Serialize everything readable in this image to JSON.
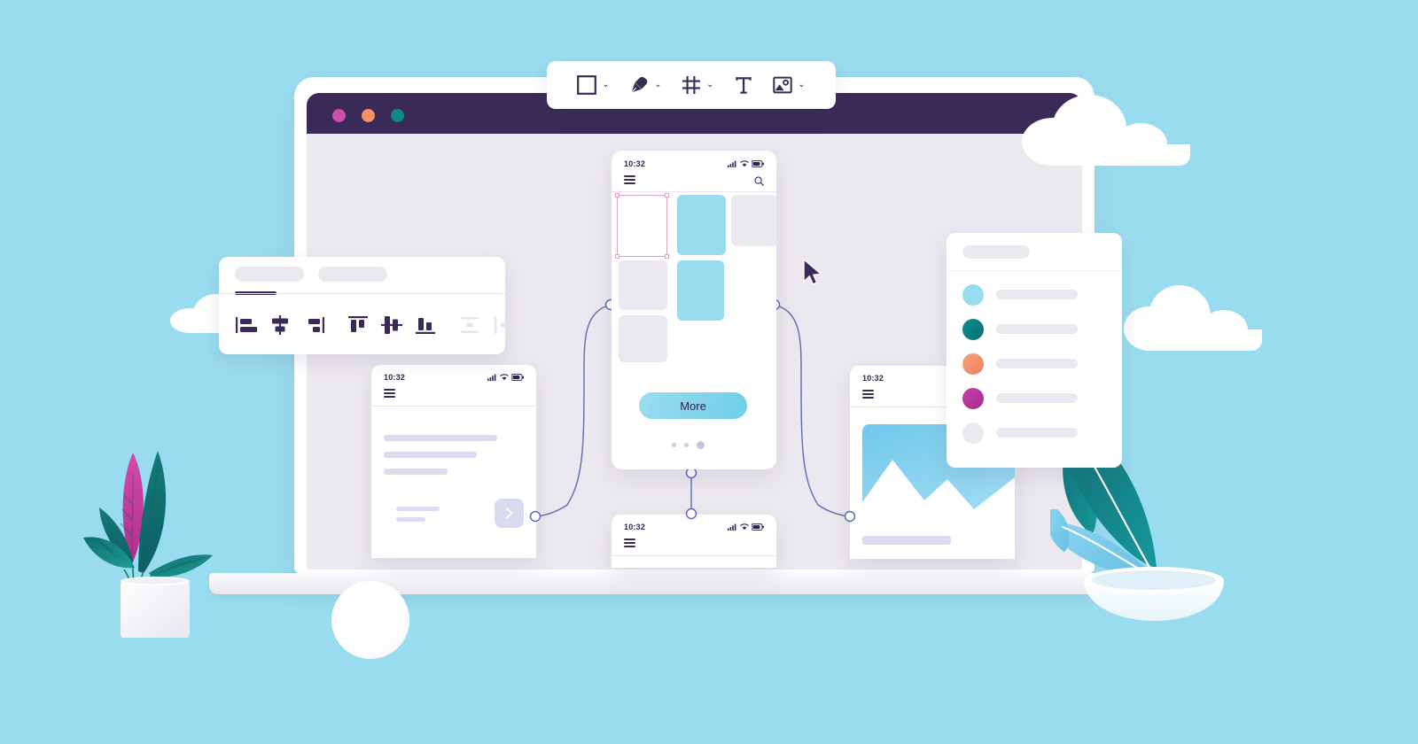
{
  "canvas": {
    "background_color": "#9adcef",
    "app_kind": "ui-design-tool-illustration"
  },
  "laptop": {
    "titlebar_color": "#3a2a57",
    "screen_color": "#ece8ef",
    "traffic_lights": [
      {
        "name": "close",
        "color": "#cf4fae"
      },
      {
        "name": "minimize",
        "color": "#f98e62"
      },
      {
        "name": "maximize",
        "color": "#0b8b8b"
      }
    ]
  },
  "top_toolbar": {
    "tools": [
      {
        "id": "shape",
        "icon": "square-icon",
        "label": "Shape",
        "has_dropdown": true
      },
      {
        "id": "pen",
        "icon": "pen-icon",
        "label": "Pen",
        "has_dropdown": true
      },
      {
        "id": "frame",
        "icon": "grid-frame-icon",
        "label": "Frame",
        "has_dropdown": true
      },
      {
        "id": "text",
        "icon": "text-t-icon",
        "label": "Text",
        "has_dropdown": false
      },
      {
        "id": "image",
        "icon": "image-icon",
        "label": "Image",
        "has_dropdown": true
      }
    ],
    "caret_glyph": "⌄"
  },
  "align_panel": {
    "tabs": [
      {
        "id": "tab-1",
        "active": true
      },
      {
        "id": "tab-2",
        "active": false
      }
    ],
    "active_underline_color": "#3a2a57",
    "buttons": [
      {
        "id": "align-left",
        "icon": "align-left-icon",
        "enabled": true
      },
      {
        "id": "align-center-horizontal",
        "icon": "align-center-horizontal-icon",
        "enabled": true
      },
      {
        "id": "align-right",
        "icon": "align-right-icon",
        "enabled": true
      },
      {
        "id": "align-top",
        "icon": "align-top-icon",
        "enabled": true
      },
      {
        "id": "align-middle-vertical",
        "icon": "align-middle-vertical-icon",
        "enabled": true
      },
      {
        "id": "align-bottom",
        "icon": "align-bottom-icon",
        "enabled": true
      },
      {
        "id": "distribute-vertical",
        "icon": "distribute-vertical-icon",
        "enabled": false
      },
      {
        "id": "distribute-horizontal",
        "icon": "distribute-horizontal-icon",
        "enabled": false
      }
    ],
    "enabled_color": "#3a2a57",
    "disabled_color": "#e7e3ec"
  },
  "phones": {
    "center": {
      "status_time": "10:32",
      "menu_icon": "hamburger-menu-icon",
      "search_icon": "search-icon",
      "more_button_label": "More",
      "more_button_color": "#9adcef",
      "pagination_dots": 3,
      "active_dot_index": 3,
      "grid_cards": [
        {
          "index": 1,
          "fill": "white",
          "selected": true
        },
        {
          "index": 2,
          "fill": "blue",
          "selected": false
        },
        {
          "index": 3,
          "fill": "gray",
          "selected": false
        },
        {
          "index": 4,
          "fill": "gray",
          "selected": false
        },
        {
          "index": 5,
          "fill": "blue",
          "selected": false
        },
        {
          "index": 6,
          "fill": "gray",
          "selected": false
        }
      ],
      "selection_handle_color": "#dba6c4"
    },
    "left": {
      "status_time": "10:32",
      "menu_icon": "hamburger-menu-icon",
      "text_line_widths": [
        128,
        105,
        72
      ],
      "next_button_icon": "chevron-right-icon"
    },
    "right": {
      "status_time": "10:32",
      "menu_icon": "hamburger-menu-icon",
      "image_placeholder": "mountain-landscape-image"
    },
    "bottom": {
      "status_time": "10:32",
      "menu_icon": "hamburger-menu-icon"
    }
  },
  "swatch_panel": {
    "rows": [
      {
        "id": "swatch-1",
        "color": "#9adcef"
      },
      {
        "id": "swatch-2",
        "color": "#0b7f81"
      },
      {
        "id": "swatch-3",
        "color": "#f5906b"
      },
      {
        "id": "swatch-4",
        "color": "#b5359a"
      },
      {
        "id": "swatch-5",
        "color": "#ece8ef"
      }
    ]
  },
  "connectors": {
    "stroke_color": "#5b6bb5",
    "endpoint_fill": "#ffffff",
    "count": 3
  },
  "cursor": {
    "icon": "mouse-pointer-icon",
    "color": "#3a2a57"
  },
  "decor": {
    "clouds": 3,
    "plant_left": {
      "leaf_color": "#147b7b",
      "accent_leaf_color": "#c4369c",
      "pot_color": "#ffffff"
    },
    "plant_right": {
      "leaf_color": "#0f7d82",
      "accent_leaf_color": "#8ed3ef",
      "pot_color": "#ffffff"
    },
    "sphere_color": "#ffffff"
  }
}
